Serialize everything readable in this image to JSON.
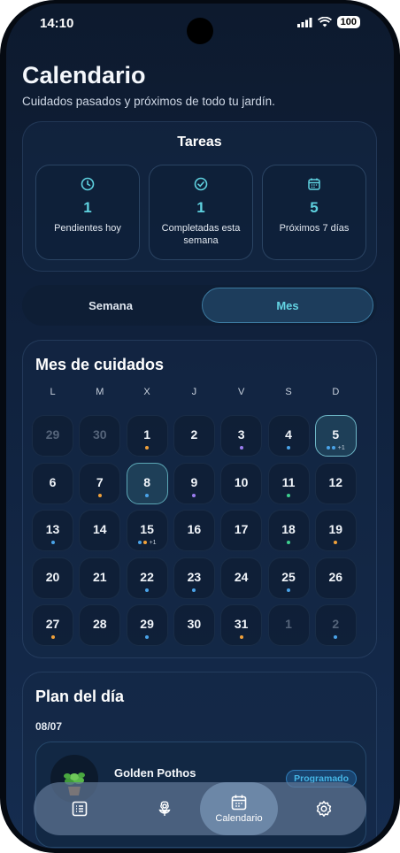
{
  "status": {
    "time": "14:10",
    "battery": "100"
  },
  "header": {
    "title": "Calendario",
    "subtitle": "Cuidados pasados y próximos de todo tu jardín."
  },
  "tasks": {
    "title": "Tareas",
    "stats": [
      {
        "icon": "clock-icon",
        "value": "1",
        "label": "Pendientes hoy"
      },
      {
        "icon": "check-circle-icon",
        "value": "1",
        "label": "Completadas esta semana"
      },
      {
        "icon": "calendar-icon",
        "value": "5",
        "label": "Próximos 7 días"
      }
    ]
  },
  "view_toggle": {
    "week_label": "Semana",
    "month_label": "Mes",
    "selected": "Mes"
  },
  "calendar": {
    "title": "Mes de cuidados",
    "weekdays": [
      "L",
      "M",
      "X",
      "J",
      "V",
      "S",
      "D"
    ],
    "colors": {
      "blue": "#4aa3e8",
      "orange": "#f0a13a",
      "purple": "#9b7df0",
      "green": "#3ecf8e"
    },
    "days": [
      {
        "n": "29",
        "muted": true,
        "dots": []
      },
      {
        "n": "30",
        "muted": true,
        "dots": []
      },
      {
        "n": "1",
        "dots": [
          "orange"
        ]
      },
      {
        "n": "2",
        "dots": []
      },
      {
        "n": "3",
        "dots": [
          "purple"
        ]
      },
      {
        "n": "4",
        "dots": [
          "blue"
        ]
      },
      {
        "n": "5",
        "dots": [
          "blue",
          "blue"
        ],
        "more": "+1",
        "today": true
      },
      {
        "n": "6",
        "dots": []
      },
      {
        "n": "7",
        "dots": [
          "orange"
        ]
      },
      {
        "n": "8",
        "dots": [
          "blue"
        ],
        "selected": true
      },
      {
        "n": "9",
        "dots": [
          "purple"
        ]
      },
      {
        "n": "10",
        "dots": []
      },
      {
        "n": "11",
        "dots": [
          "green"
        ]
      },
      {
        "n": "12",
        "dots": []
      },
      {
        "n": "13",
        "dots": [
          "blue"
        ]
      },
      {
        "n": "14",
        "dots": []
      },
      {
        "n": "15",
        "dots": [
          "blue",
          "orange"
        ],
        "more": "+1"
      },
      {
        "n": "16",
        "dots": []
      },
      {
        "n": "17",
        "dots": []
      },
      {
        "n": "18",
        "dots": [
          "green"
        ]
      },
      {
        "n": "19",
        "dots": [
          "orange"
        ]
      },
      {
        "n": "20",
        "dots": []
      },
      {
        "n": "21",
        "dots": []
      },
      {
        "n": "22",
        "dots": [
          "blue"
        ]
      },
      {
        "n": "23",
        "dots": [
          "blue"
        ]
      },
      {
        "n": "24",
        "dots": []
      },
      {
        "n": "25",
        "dots": [
          "blue"
        ]
      },
      {
        "n": "26",
        "dots": []
      },
      {
        "n": "27",
        "dots": [
          "orange"
        ]
      },
      {
        "n": "28",
        "dots": []
      },
      {
        "n": "29",
        "dots": [
          "blue"
        ]
      },
      {
        "n": "30",
        "dots": []
      },
      {
        "n": "31",
        "dots": [
          "orange"
        ]
      },
      {
        "n": "1",
        "muted": true,
        "dots": []
      },
      {
        "n": "2",
        "muted": true,
        "dots": [
          "blue"
        ]
      }
    ]
  },
  "plan": {
    "title": "Plan del día",
    "date": "08/07",
    "item": {
      "plant": "Golden Pothos",
      "status": "Programado",
      "thumb_icon": "potted-plant-icon"
    }
  },
  "tabbar": {
    "tabs": [
      {
        "icon": "list-icon",
        "label": ""
      },
      {
        "icon": "flower-icon",
        "label": ""
      },
      {
        "icon": "calendar-icon",
        "label": "Calendario",
        "active": true
      },
      {
        "icon": "gear-icon",
        "label": ""
      }
    ]
  }
}
